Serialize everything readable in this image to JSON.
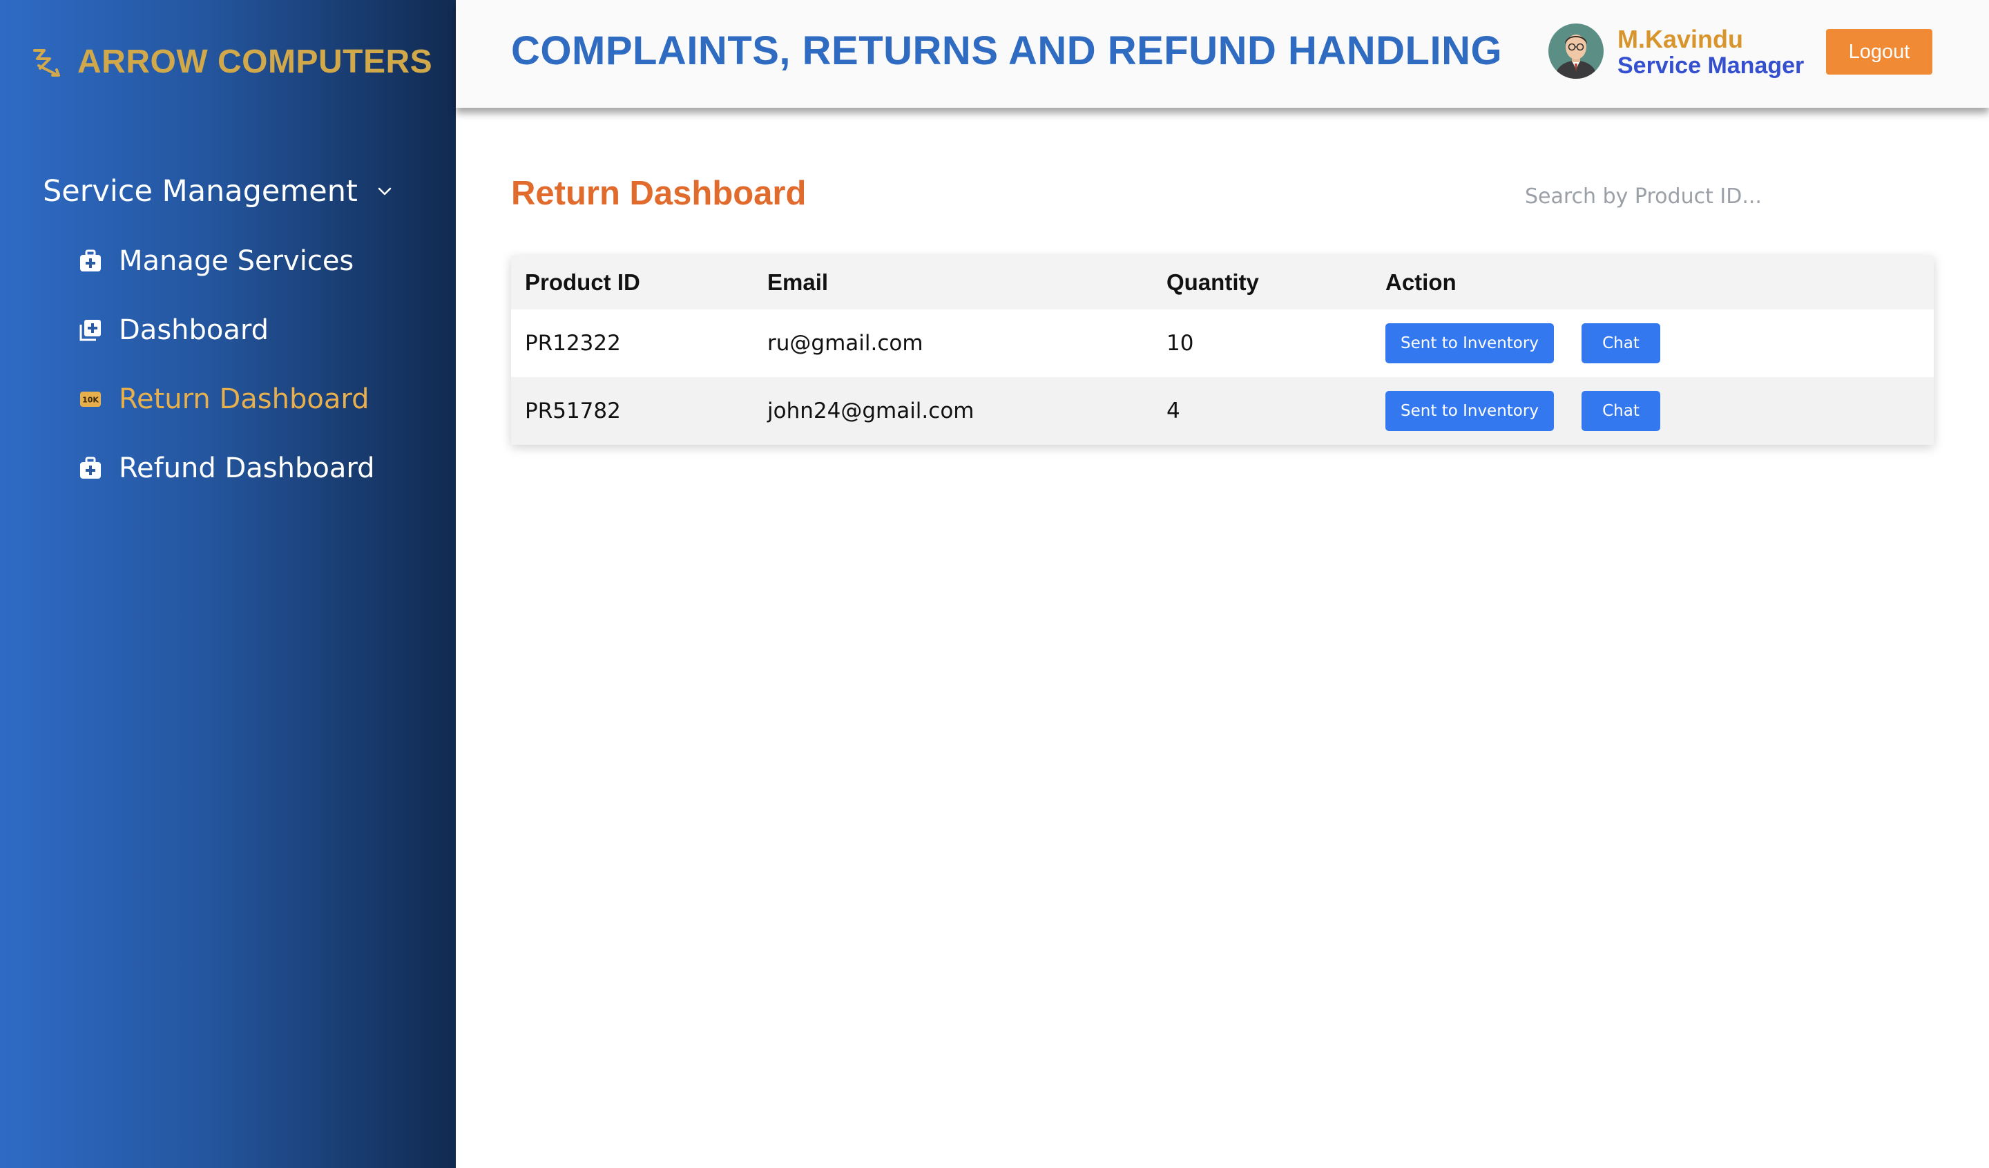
{
  "brand": {
    "name": "ARROW COMPUTERS",
    "icon": "arrow-logo-icon"
  },
  "sidebar": {
    "group_label": "Service Management",
    "items": [
      {
        "label": "Manage Services",
        "icon": "medkit-icon",
        "active": false
      },
      {
        "label": "Dashboard",
        "icon": "add-square-icon",
        "active": false
      },
      {
        "label": "Return Dashboard",
        "icon": "badge-10k-icon",
        "active": true
      },
      {
        "label": "Refund Dashboard",
        "icon": "medkit-icon",
        "active": false
      }
    ]
  },
  "header": {
    "title": "COMPLAINTS, RETURNS AND REFUND HANDLING",
    "user": {
      "name": "M.Kavindu",
      "role": "Service Manager"
    },
    "logout_label": "Logout"
  },
  "main": {
    "title": "Return Dashboard",
    "search": {
      "placeholder": "Search by Product ID...",
      "value": ""
    },
    "table": {
      "columns": [
        "Product ID",
        "Email",
        "Quantity",
        "Action"
      ],
      "rows": [
        {
          "product_id": "PR12322",
          "email": "ru@gmail.com",
          "quantity": "10",
          "inventory_label": "Sent to Inventory",
          "chat_label": "Chat"
        },
        {
          "product_id": "PR51782",
          "email": "john24@gmail.com",
          "quantity": "4",
          "inventory_label": "Sent to Inventory",
          "chat_label": "Chat"
        }
      ]
    }
  },
  "colors": {
    "brand_gold": "#d2a94a",
    "active_nav": "#e8b04c",
    "heading_blue": "#2f6bc0",
    "section_orange": "#e06b2c",
    "logout_orange": "#f08a34",
    "action_blue": "#3478f0"
  }
}
